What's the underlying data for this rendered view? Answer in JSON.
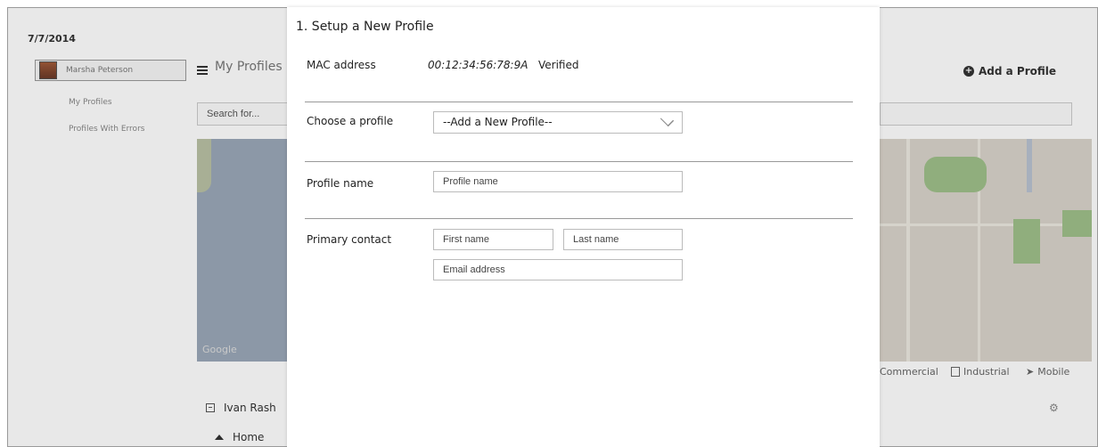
{
  "background": {
    "date": "7/7/2014",
    "user": "Marsha Peterson",
    "sidebar": [
      "My Profiles",
      "Profiles With Errors"
    ],
    "page_title": "My Profiles",
    "search_placeholder": "Search for...",
    "add_profile_label": "Add a Profile",
    "map_attribution": "Google",
    "legend": [
      {
        "label": "Commercial",
        "icon": "commercial-icon"
      },
      {
        "label": "Industrial",
        "icon": "industrial-icon"
      },
      {
        "label": "Mobile",
        "icon": "mobile-icon"
      }
    ],
    "contact_name": "Ivan Rash",
    "home_label": "Home"
  },
  "modal": {
    "title": "1. Setup a New Profile",
    "mac": {
      "label": "MAC address",
      "value": "00:12:34:56:78:9A",
      "status": "Verified"
    },
    "choose_profile": {
      "label": "Choose a profile",
      "selected": "--Add a New Profile--"
    },
    "profile_name": {
      "label": "Profile name",
      "placeholder": "Profile name"
    },
    "primary_contact": {
      "label": "Primary contact",
      "first_placeholder": "First name",
      "last_placeholder": "Last name",
      "email_placeholder": "Email address"
    }
  }
}
